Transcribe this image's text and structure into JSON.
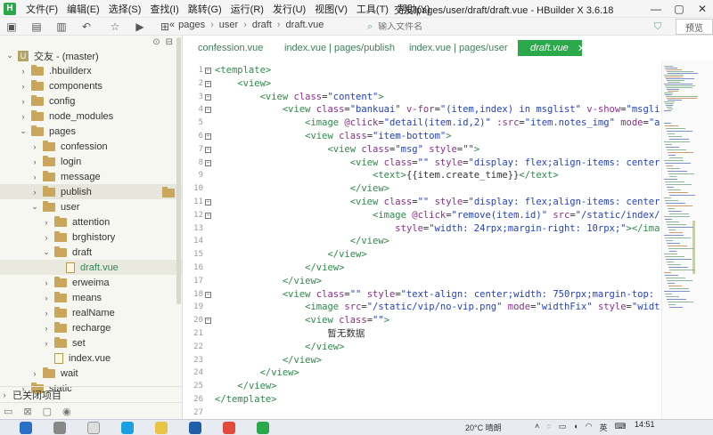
{
  "app": {
    "logo": "H",
    "menu": [
      "文件(F)",
      "编辑(E)",
      "选择(S)",
      "查找(I)",
      "跳转(G)",
      "运行(R)",
      "发行(U)",
      "视图(V)",
      "工具(T)",
      "帮助(Y)"
    ],
    "window_title": "交友/pages/user/draft/draft.vue - HBuilder X 3.6.18"
  },
  "toolbar": {
    "breadcrumb": [
      "pages",
      "user",
      "draft",
      "draft.vue"
    ],
    "search_placeholder": "输入文件名",
    "preview_label": "预览"
  },
  "sidebar": {
    "project": "交友 - (master)",
    "items": [
      {
        "label": ".hbuilderx",
        "depth": 1,
        "expanded": false
      },
      {
        "label": "components",
        "depth": 1,
        "expanded": false
      },
      {
        "label": "config",
        "depth": 1,
        "expanded": false
      },
      {
        "label": "node_modules",
        "depth": 1,
        "expanded": false
      },
      {
        "label": "pages",
        "depth": 1,
        "expanded": true
      },
      {
        "label": "confession",
        "depth": 2,
        "expanded": false
      },
      {
        "label": "login",
        "depth": 2,
        "expanded": false
      },
      {
        "label": "message",
        "depth": 2,
        "expanded": false
      },
      {
        "label": "publish",
        "depth": 2,
        "expanded": false
      },
      {
        "label": "user",
        "depth": 2,
        "expanded": true
      },
      {
        "label": "attention",
        "depth": 3,
        "expanded": false
      },
      {
        "label": "brghistory",
        "depth": 3,
        "expanded": false
      },
      {
        "label": "draft",
        "depth": 3,
        "expanded": true
      },
      {
        "label": "draft.vue",
        "depth": 4,
        "file": true
      },
      {
        "label": "erweima",
        "depth": 3,
        "expanded": false
      },
      {
        "label": "means",
        "depth": 3,
        "expanded": false
      },
      {
        "label": "realName",
        "depth": 3,
        "expanded": false
      },
      {
        "label": "recharge",
        "depth": 3,
        "expanded": false
      },
      {
        "label": "set",
        "depth": 3,
        "expanded": false
      },
      {
        "label": "index.vue",
        "depth": 3,
        "file": true
      },
      {
        "label": "wait",
        "depth": 2,
        "expanded": false
      },
      {
        "label": "static",
        "depth": 1,
        "expanded": false
      }
    ],
    "closed_projects": "已关闭项目"
  },
  "tabs": [
    {
      "label": "confession.vue"
    },
    {
      "label": "index.vue | pages/publish"
    },
    {
      "label": "index.vue | pages/user"
    },
    {
      "label": "draft.vue",
      "active": true
    }
  ],
  "editor": {
    "lines": [
      {
        "n": "1",
        "fold": "⊟",
        "parts": [
          [
            "t",
            "<template>"
          ]
        ]
      },
      {
        "n": "2",
        "fold": "⊟",
        "parts": [
          [
            "p",
            "    "
          ],
          [
            "t",
            "<view>"
          ]
        ]
      },
      {
        "n": "3",
        "fold": "⊟",
        "parts": [
          [
            "p",
            "        "
          ],
          [
            "t",
            "<view "
          ],
          [
            "a",
            "class"
          ],
          [
            "p",
            "="
          ],
          [
            "s",
            "\"content\""
          ],
          [
            "t",
            ">"
          ]
        ]
      },
      {
        "n": "4",
        "fold": "⊟",
        "parts": [
          [
            "p",
            "            "
          ],
          [
            "t",
            "<view "
          ],
          [
            "a",
            "class"
          ],
          [
            "p",
            "="
          ],
          [
            "s",
            "\"bankuai\" "
          ],
          [
            "a",
            "v-for"
          ],
          [
            "p",
            "="
          ],
          [
            "s",
            "\"(item,index) in msglist\" "
          ],
          [
            "a",
            "v-show"
          ],
          [
            "p",
            "="
          ],
          [
            "s",
            "\"msglist"
          ]
        ]
      },
      {
        "n": "5",
        "fold": "",
        "parts": [
          [
            "p",
            "                "
          ],
          [
            "t",
            "<image "
          ],
          [
            "a",
            "@click"
          ],
          [
            "p",
            "="
          ],
          [
            "s",
            "\"detail(item.id,2)\" "
          ],
          [
            "a",
            ":src"
          ],
          [
            "p",
            "="
          ],
          [
            "s",
            "\"item.notes_img\" "
          ],
          [
            "a",
            "mode"
          ],
          [
            "p",
            "="
          ],
          [
            "s",
            "\"asp"
          ]
        ]
      },
      {
        "n": "6",
        "fold": "⊟",
        "parts": [
          [
            "p",
            "                "
          ],
          [
            "t",
            "<view "
          ],
          [
            "a",
            "class"
          ],
          [
            "p",
            "="
          ],
          [
            "s",
            "\"item-bottom\""
          ],
          [
            "t",
            ">"
          ]
        ]
      },
      {
        "n": "7",
        "fold": "⊟",
        "parts": [
          [
            "p",
            "                    "
          ],
          [
            "t",
            "<view "
          ],
          [
            "a",
            "class"
          ],
          [
            "p",
            "="
          ],
          [
            "s",
            "\"msg\" "
          ],
          [
            "a",
            "style"
          ],
          [
            "p",
            "="
          ],
          [
            "s",
            "\"\""
          ],
          [
            "t",
            ">"
          ]
        ]
      },
      {
        "n": "8",
        "fold": "⊟",
        "parts": [
          [
            "p",
            "                        "
          ],
          [
            "t",
            "<view "
          ],
          [
            "a",
            "class"
          ],
          [
            "p",
            "="
          ],
          [
            "s",
            "\"\" "
          ],
          [
            "a",
            "style"
          ],
          [
            "p",
            "="
          ],
          [
            "s",
            "\"display: flex;align-items: center;"
          ]
        ]
      },
      {
        "n": "9",
        "fold": "",
        "parts": [
          [
            "p",
            "                            "
          ],
          [
            "t",
            "<text>"
          ],
          [
            "p",
            "{{item.create_time}}"
          ],
          [
            "t",
            "</text>"
          ]
        ]
      },
      {
        "n": "10",
        "fold": "",
        "parts": [
          [
            "p",
            "                        "
          ],
          [
            "t",
            "</view>"
          ]
        ]
      },
      {
        "n": "11",
        "fold": "⊟",
        "parts": [
          [
            "p",
            "                        "
          ],
          [
            "t",
            "<view "
          ],
          [
            "a",
            "class"
          ],
          [
            "p",
            "="
          ],
          [
            "s",
            "\"\" "
          ],
          [
            "a",
            "style"
          ],
          [
            "p",
            "="
          ],
          [
            "s",
            "\"display: flex;align-items: center;"
          ]
        ]
      },
      {
        "n": "12",
        "fold": "⊟",
        "parts": [
          [
            "p",
            "                            "
          ],
          [
            "t",
            "<image "
          ],
          [
            "a",
            "@click"
          ],
          [
            "p",
            "="
          ],
          [
            "s",
            "\"remove(item.id)\" "
          ],
          [
            "a",
            "src"
          ],
          [
            "p",
            "="
          ],
          [
            "s",
            "\"/static/index/de"
          ]
        ]
      },
      {
        "n": "13",
        "fold": "",
        "parts": [
          [
            "p",
            "                                "
          ],
          [
            "a",
            "style"
          ],
          [
            "p",
            "="
          ],
          [
            "s",
            "\"width: 24rpx;margin-right: 10rpx;\""
          ],
          [
            "t",
            "></image"
          ]
        ]
      },
      {
        "n": "14",
        "fold": "",
        "parts": [
          [
            "p",
            "                        "
          ],
          [
            "t",
            "</view>"
          ]
        ]
      },
      {
        "n": "15",
        "fold": "",
        "parts": [
          [
            "p",
            "                    "
          ],
          [
            "t",
            "</view>"
          ]
        ]
      },
      {
        "n": "16",
        "fold": "",
        "parts": [
          [
            "p",
            "                "
          ],
          [
            "t",
            "</view>"
          ]
        ]
      },
      {
        "n": "17",
        "fold": "",
        "parts": [
          [
            "p",
            "            "
          ],
          [
            "t",
            "</view>"
          ]
        ]
      },
      {
        "n": "18",
        "fold": "⊟",
        "parts": [
          [
            "p",
            "            "
          ],
          [
            "t",
            "<view "
          ],
          [
            "a",
            "class"
          ],
          [
            "p",
            "="
          ],
          [
            "s",
            "\"\" "
          ],
          [
            "a",
            "style"
          ],
          [
            "p",
            "="
          ],
          [
            "s",
            "\"text-align: center;width: 750rpx;margin-top: 28"
          ]
        ]
      },
      {
        "n": "19",
        "fold": "",
        "parts": [
          [
            "p",
            "                "
          ],
          [
            "t",
            "<image "
          ],
          [
            "a",
            "src"
          ],
          [
            "p",
            "="
          ],
          [
            "s",
            "\"/static/vip/no-vip.png\" "
          ],
          [
            "a",
            "mode"
          ],
          [
            "p",
            "="
          ],
          [
            "s",
            "\"widthFix\" "
          ],
          [
            "a",
            "style"
          ],
          [
            "p",
            "="
          ],
          [
            "s",
            "\"width:"
          ]
        ]
      },
      {
        "n": "20",
        "fold": "⊟",
        "parts": [
          [
            "p",
            "                "
          ],
          [
            "t",
            "<view "
          ],
          [
            "a",
            "class"
          ],
          [
            "p",
            "="
          ],
          [
            "s",
            "\"\""
          ],
          [
            "t",
            ">"
          ]
        ]
      },
      {
        "n": "21",
        "fold": "",
        "parts": [
          [
            "p",
            "                    暂无数据"
          ]
        ]
      },
      {
        "n": "22",
        "fold": "",
        "parts": [
          [
            "p",
            "                "
          ],
          [
            "t",
            "</view>"
          ]
        ]
      },
      {
        "n": "23",
        "fold": "",
        "parts": [
          [
            "p",
            "            "
          ],
          [
            "t",
            "</view>"
          ]
        ]
      },
      {
        "n": "24",
        "fold": "",
        "parts": [
          [
            "p",
            "        "
          ],
          [
            "t",
            "</view>"
          ]
        ]
      },
      {
        "n": "25",
        "fold": "",
        "parts": [
          [
            "p",
            "    "
          ],
          [
            "t",
            "</view>"
          ]
        ]
      },
      {
        "n": "26",
        "fold": "",
        "parts": [
          [
            "t",
            "</template>"
          ]
        ]
      },
      {
        "n": "27",
        "fold": "",
        "parts": []
      }
    ]
  },
  "taskbar": {
    "weather": "20°C 晴朗",
    "ime": "英",
    "time": "14:51"
  }
}
